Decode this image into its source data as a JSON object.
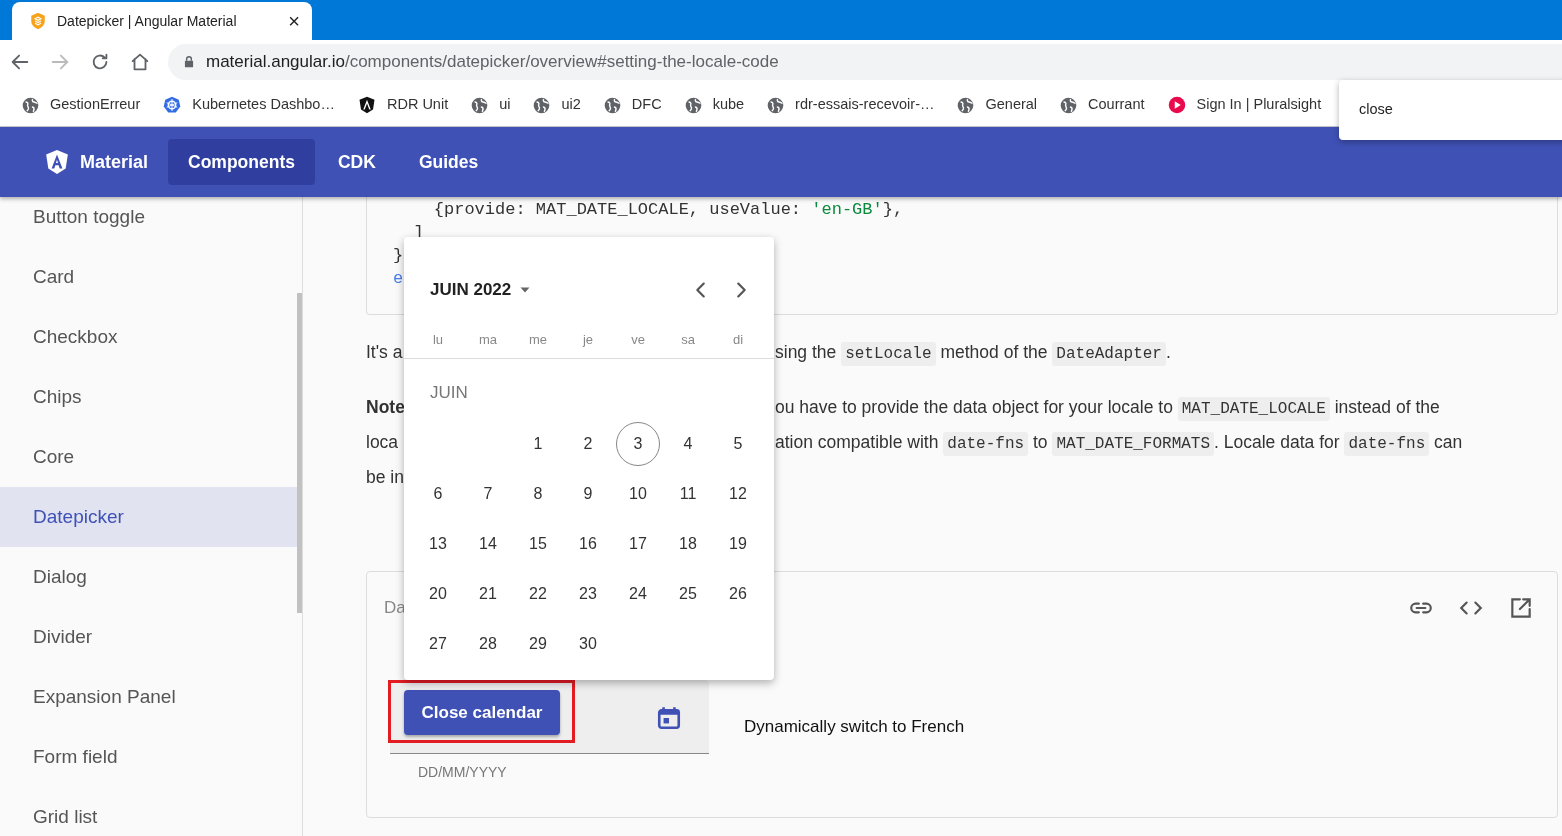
{
  "browser": {
    "tab": {
      "title": "Datepicker | Angular Material",
      "close_glyph": "×"
    },
    "address": {
      "host": "material.angular.io",
      "path": "/components/datepicker/overview#setting-the-locale-code"
    },
    "bookmarks": [
      {
        "label": "GestionErreur",
        "kind": "globe"
      },
      {
        "label": "Kubernetes Dashbo…",
        "kind": "kubernetes"
      },
      {
        "label": "RDR Unit",
        "kind": "angular"
      },
      {
        "label": "ui",
        "kind": "globe"
      },
      {
        "label": "ui2",
        "kind": "globe"
      },
      {
        "label": "DFC",
        "kind": "globe"
      },
      {
        "label": "kube",
        "kind": "globe"
      },
      {
        "label": "rdr-essais-recevoir-…",
        "kind": "globe"
      },
      {
        "label": "General",
        "kind": "globe"
      },
      {
        "label": "Courrant",
        "kind": "globe"
      },
      {
        "label": "Sign In | Pluralsight",
        "kind": "pluralsight"
      }
    ]
  },
  "tooltip": {
    "text": "close"
  },
  "app_bar": {
    "brand": "Material",
    "links": [
      {
        "label": "Components",
        "selected": true
      },
      {
        "label": "CDK",
        "selected": false
      },
      {
        "label": "Guides",
        "selected": false
      }
    ]
  },
  "sidebar": {
    "items": [
      {
        "label": "Button toggle",
        "selected": false
      },
      {
        "label": "Card",
        "selected": false
      },
      {
        "label": "Checkbox",
        "selected": false
      },
      {
        "label": "Chips",
        "selected": false
      },
      {
        "label": "Core",
        "selected": false
      },
      {
        "label": "Datepicker",
        "selected": true
      },
      {
        "label": "Dialog",
        "selected": false
      },
      {
        "label": "Divider",
        "selected": false
      },
      {
        "label": "Expansion Panel",
        "selected": false
      },
      {
        "label": "Form field",
        "selected": false
      },
      {
        "label": "Grid list",
        "selected": false
      }
    ]
  },
  "code_block": {
    "lines": [
      [
        {
          "kind": "plain",
          "text": "    {provide: MAT_DATE_LOCALE, useValue: "
        },
        {
          "kind": "string",
          "text": "'en-GB'"
        },
        {
          "kind": "plain",
          "text": "},"
        }
      ],
      [
        {
          "kind": "plain",
          "text": "  ]"
        }
      ],
      [
        {
          "kind": "plain",
          "text": "}"
        }
      ],
      [
        {
          "kind": "keyword",
          "text": "e"
        }
      ]
    ]
  },
  "paragraphs": [
    {
      "lines": [
        {
          "left": [
            {
              "kind": "text",
              "text": "It's a"
            }
          ],
          "right": [
            {
              "kind": "text",
              "text": "sing the "
            },
            {
              "kind": "code",
              "text": "setLocale"
            },
            {
              "kind": "text",
              "text": " method of the "
            },
            {
              "kind": "code",
              "text": "DateAdapter"
            },
            {
              "kind": "text",
              "text": "."
            }
          ]
        }
      ]
    },
    {
      "lines": [
        {
          "left": [
            {
              "kind": "bold",
              "text": "Note"
            }
          ],
          "right": [
            {
              "kind": "text",
              "text": "ou have to provide the data object for your locale to "
            },
            {
              "kind": "code",
              "text": "MAT_DATE_LOCALE"
            },
            {
              "kind": "text",
              "text": " instead of the"
            }
          ]
        },
        {
          "left": [
            {
              "kind": "text",
              "text": "loca"
            }
          ],
          "right": [
            {
              "kind": "text",
              "text": "ation compatible with "
            },
            {
              "kind": "code",
              "text": "date-fns"
            },
            {
              "kind": "text",
              "text": " to "
            },
            {
              "kind": "code",
              "text": "MAT_DATE_FORMATS"
            },
            {
              "kind": "text",
              "text": ". Locale data for "
            },
            {
              "kind": "code",
              "text": "date-fns"
            },
            {
              "kind": "text",
              "text": " can"
            }
          ]
        },
        {
          "left": [
            {
              "kind": "text",
              "text": "be in"
            }
          ]
        }
      ]
    }
  ],
  "demo": {
    "title": "Da",
    "field": {
      "button": "Close calendar",
      "hint": "DD/MM/YYYY",
      "highlighted": true
    },
    "switch_button": "Dynamically switch to French"
  },
  "calendar": {
    "period": "JUIN 2022",
    "weekdays": [
      "lu",
      "ma",
      "me",
      "je",
      "ve",
      "sa",
      "di"
    ],
    "month_label": "JUIN",
    "weeks": [
      [
        {
          "kind": "blank"
        },
        {
          "kind": "blank"
        },
        {
          "kind": "day",
          "label": "1",
          "today": false
        },
        {
          "kind": "day",
          "label": "2",
          "today": false
        },
        {
          "kind": "day",
          "label": "3",
          "today": true
        },
        {
          "kind": "day",
          "label": "4",
          "today": false
        },
        {
          "kind": "day",
          "label": "5",
          "today": false
        }
      ],
      [
        {
          "kind": "day",
          "label": "6",
          "today": false
        },
        {
          "kind": "day",
          "label": "7",
          "today": false
        },
        {
          "kind": "day",
          "label": "8",
          "today": false
        },
        {
          "kind": "day",
          "label": "9",
          "today": false
        },
        {
          "kind": "day",
          "label": "10",
          "today": false
        },
        {
          "kind": "day",
          "label": "11",
          "today": false
        },
        {
          "kind": "day",
          "label": "12",
          "today": false
        }
      ],
      [
        {
          "kind": "day",
          "label": "13",
          "today": false
        },
        {
          "kind": "day",
          "label": "14",
          "today": false
        },
        {
          "kind": "day",
          "label": "15",
          "today": false
        },
        {
          "kind": "day",
          "label": "16",
          "today": false
        },
        {
          "kind": "day",
          "label": "17",
          "today": false
        },
        {
          "kind": "day",
          "label": "18",
          "today": false
        },
        {
          "kind": "day",
          "label": "19",
          "today": false
        }
      ],
      [
        {
          "kind": "day",
          "label": "20",
          "today": false
        },
        {
          "kind": "day",
          "label": "21",
          "today": false
        },
        {
          "kind": "day",
          "label": "22",
          "today": false
        },
        {
          "kind": "day",
          "label": "23",
          "today": false
        },
        {
          "kind": "day",
          "label": "24",
          "today": false
        },
        {
          "kind": "day",
          "label": "25",
          "today": false
        },
        {
          "kind": "day",
          "label": "26",
          "today": false
        }
      ],
      [
        {
          "kind": "day",
          "label": "27",
          "today": false
        },
        {
          "kind": "day",
          "label": "28",
          "today": false
        },
        {
          "kind": "day",
          "label": "29",
          "today": false
        },
        {
          "kind": "day",
          "label": "30",
          "today": false
        }
      ]
    ]
  }
}
